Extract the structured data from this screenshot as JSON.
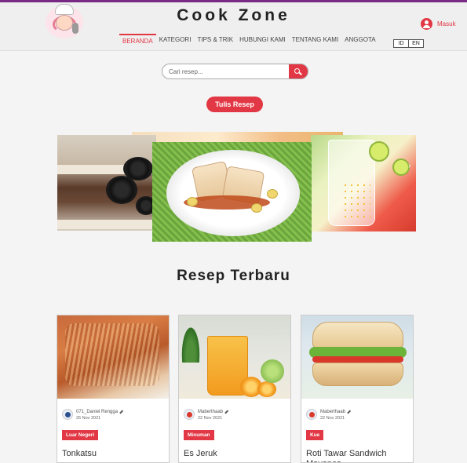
{
  "header": {
    "site_title": "Cook Zone",
    "login_label": "Masuk",
    "nav": [
      "BERANDA",
      "KATEGORI",
      "TIPS & TRIK",
      "HUBUNGI KAMI",
      "TENTANG KAMI",
      "ANGGOTA"
    ],
    "nav_active": "BERANDA",
    "lang": [
      "ID",
      "EN"
    ]
  },
  "search": {
    "placeholder": "Cari resep..."
  },
  "write_button": "Tulis Resep",
  "section_title": "Resep Terbaru",
  "cards": [
    {
      "author": "071_Daniel Rengga",
      "date": "26 Nov 2021",
      "category": "Luar Negeri",
      "title": "Tonkatsu"
    },
    {
      "author": "Maberthaab",
      "date": "22 Nov 2021",
      "category": "Minuman",
      "title": "Es Jeruk"
    },
    {
      "author": "Maberthaab",
      "date": "22 Nov 2021",
      "category": "Kue",
      "title": "Roti Tawar Sandwich Mayones"
    }
  ],
  "colors": {
    "accent": "#e23744",
    "topline": "#7a2a86"
  }
}
